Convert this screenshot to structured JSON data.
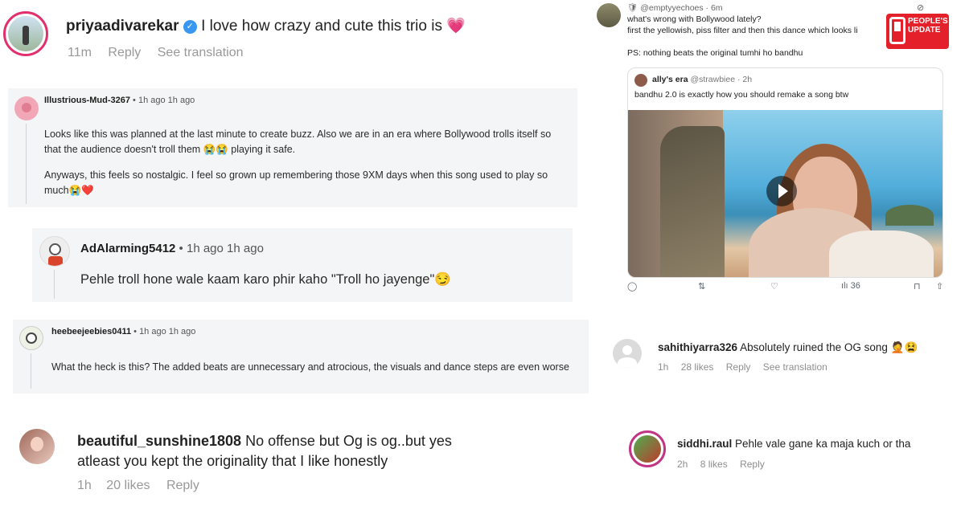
{
  "left": {
    "ig_top": {
      "username": "priyaadivarekar",
      "comment": "I love how crazy and cute this trio is",
      "heart_emoji": "💗",
      "time": "11m",
      "reply": "Reply",
      "see_translation": "See translation"
    },
    "reddit1": {
      "username": "Illustrious-Mud-3267",
      "dot": "•",
      "time": "1h ago 1h ago",
      "para1": "Looks like this was planned at the last minute to create buzz. Also we are in an era where Bollywood trolls itself so that the audience doesn't troll them 😭😭 playing it safe.",
      "para2": "Anyways, this feels so nostalgic. I feel so grown up remembering those 9XM days when this song used to play so much😭❤️"
    },
    "reddit2": {
      "username": "AdAlarming5412",
      "dot": "•",
      "time": "1h ago 1h ago",
      "text": "Pehle troll hone wale kaam karo phir kaho \"Troll ho jayenge\"😏"
    },
    "reddit3": {
      "username": "heebeejeebies0411",
      "dot": "•",
      "time": "1h ago 1h ago",
      "text": "What the heck is this? The added beats are unnecessary and atrocious, the visuals and dance steps are even worse"
    },
    "ig_bottom": {
      "username": "beautiful_sunshine1808",
      "comment_line1": "No offense but Og is og..but yes",
      "comment_line2": "atleast you kept the originality that I like honestly",
      "time": "1h",
      "likes": "20 likes",
      "reply": "Reply"
    }
  },
  "right": {
    "tweet": {
      "handle": "@emptyyechoes · 6m",
      "line1": "what's wrong with Bollywood lately?",
      "line2": "first the yellowish, piss filter and then this dance which looks li",
      "line3": "PS: nothing beats the original tumhi ho bandhu",
      "quote_name": "ally's era",
      "quote_handle": "@strawbiee · 2h",
      "quote_text": "bandhu 2.0 is exactly how you should remake a song btw",
      "views": "36"
    },
    "logo": {
      "line1": "PEOPLE'S",
      "line2": "UPDATE",
      "brand_color": "#e4202a"
    },
    "ig1": {
      "username": "sahithiyarra326",
      "comment": "Absolutely ruined the OG song",
      "emojis": "🤦😫",
      "time": "1h",
      "likes": "28 likes",
      "reply": "Reply",
      "see_translation": "See translation"
    },
    "ig2": {
      "username": "siddhi.raul",
      "comment": "Pehle vale gane ka maja kuch or tha",
      "time": "2h",
      "likes": "8 likes",
      "reply": "Reply"
    }
  }
}
